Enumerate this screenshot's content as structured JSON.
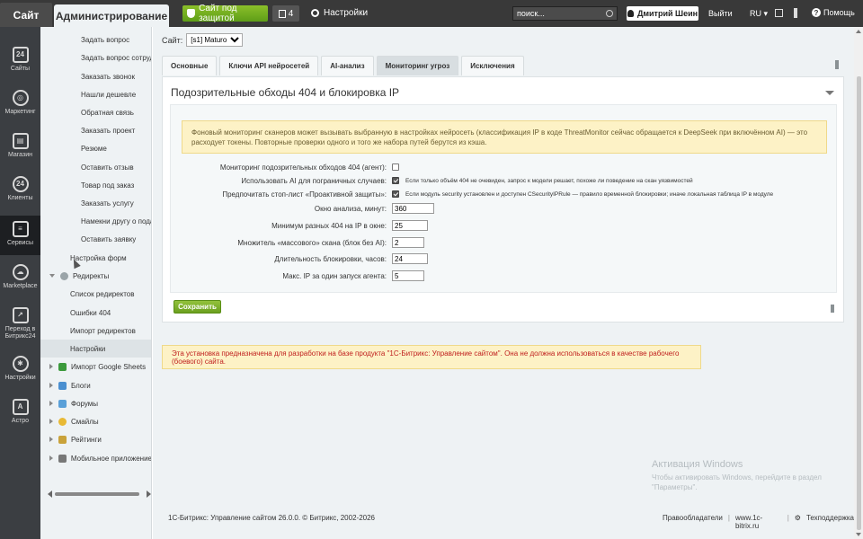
{
  "topbar": {
    "site_tab": "Сайт",
    "admin_tab": "Администрирование",
    "protect_btn": "Сайт под защитой",
    "notif_count": "4",
    "settings": "Настройки",
    "search_placeholder": "поиск...",
    "user": "Дмитрий Шеин",
    "logout": "Выйти",
    "lang": "RU",
    "help": "Помощь"
  },
  "iconbar": [
    {
      "label": "Сайты",
      "icon": "calendar-icon"
    },
    {
      "label": "Маркетинг",
      "icon": "target-icon"
    },
    {
      "label": "Магазин",
      "icon": "cart-icon"
    },
    {
      "label": "Клиенты",
      "icon": "clients-icon"
    },
    {
      "label": "Сервисы",
      "icon": "layers-icon"
    },
    {
      "label": "Marketplace",
      "icon": "cloud-icon"
    },
    {
      "label": "Переход в Битрикс24",
      "icon": "bitrix24-icon"
    },
    {
      "label": "Настройки",
      "icon": "gear-icon"
    },
    {
      "label": "Астро",
      "icon": "astro-icon"
    }
  ],
  "tree": {
    "items": [
      "Задать вопрос",
      "Задать вопрос сотрудн",
      "Заказать звонок",
      "Нашли дешевле",
      "Обратная связь",
      "Заказать проект",
      "Резюме",
      "Оставить отзыв",
      "Товар под заказ",
      "Заказать услугу",
      "Намекни другу о подар",
      "Оставить заявку",
      "Настройка форм",
      "Редиректы",
      "Список редиректов",
      "Ошибки 404",
      "Импорт редиректов",
      "Настройки",
      "Импорт Google Sheets",
      "Блоги",
      "Форумы",
      "Смайлы",
      "Рейтинги",
      "Мобильное приложение"
    ]
  },
  "main": {
    "site_label": "Сайт:",
    "site_value": "[s1] Maturo",
    "tabs": [
      "Основные",
      "Ключи API нейросетей",
      "AI-анализ",
      "Мониторинг угроз",
      "Исключения"
    ],
    "panel_title": "Подозрительные обходы 404 и блокировка IP",
    "note": "Фоновый мониторинг сканеров может вызывать выбранную в настройках нейросеть (классификация IP в коде ThreatMonitor сейчас обращается к DeepSeek при включённом AI) — это расходует токены. Повторные проверки одного и того же набора путей берутся из кэша.",
    "rows": {
      "r1_label": "Мониторинг подозрительных обходов 404 (агент):",
      "r2_label": "Использовать AI для пограничных случаев:",
      "r2_hint": "Если только объём 404 не очевиден, запрос к модели решает, похоже ли поведение на скан уязвимостей",
      "r3_label": "Предпочитать стоп-лист «Проактивной защиты»:",
      "r3_hint": "Если модуль security установлен и доступен CSecurityIPRule — правило временной блокировки; иначе локальная таблица IP в модуле",
      "r4_label": "Окно анализа, минут:",
      "r4_value": "360",
      "r5_label": "Минимум разных 404 на IP в окне:",
      "r5_value": "25",
      "r6_label": "Множитель «массового» скана (блок без AI):",
      "r6_value": "2",
      "r7_label": "Длительность блокировки, часов:",
      "r7_value": "24",
      "r8_label": "Макс. IP за один запуск агента:",
      "r8_value": "5"
    },
    "save": "Сохранить",
    "warning": "Эта установка предназначена для разработки на базе продукта \"1С-Битрикс: Управление сайтом\". Она не должна использоваться в качестве рабочего (боевого) сайта.",
    "activation_title": "Активация Windows",
    "activation_text": "Чтобы активировать Windows, перейдите в раздел \"Параметры\".",
    "footer_left": "1С-Битрикс: Управление сайтом 26.0.0. © Битрикс, 2002-2026",
    "footer_rights": "Правообладатели",
    "footer_site": "www.1c-bitrix.ru",
    "footer_support": "Техподдержка"
  }
}
